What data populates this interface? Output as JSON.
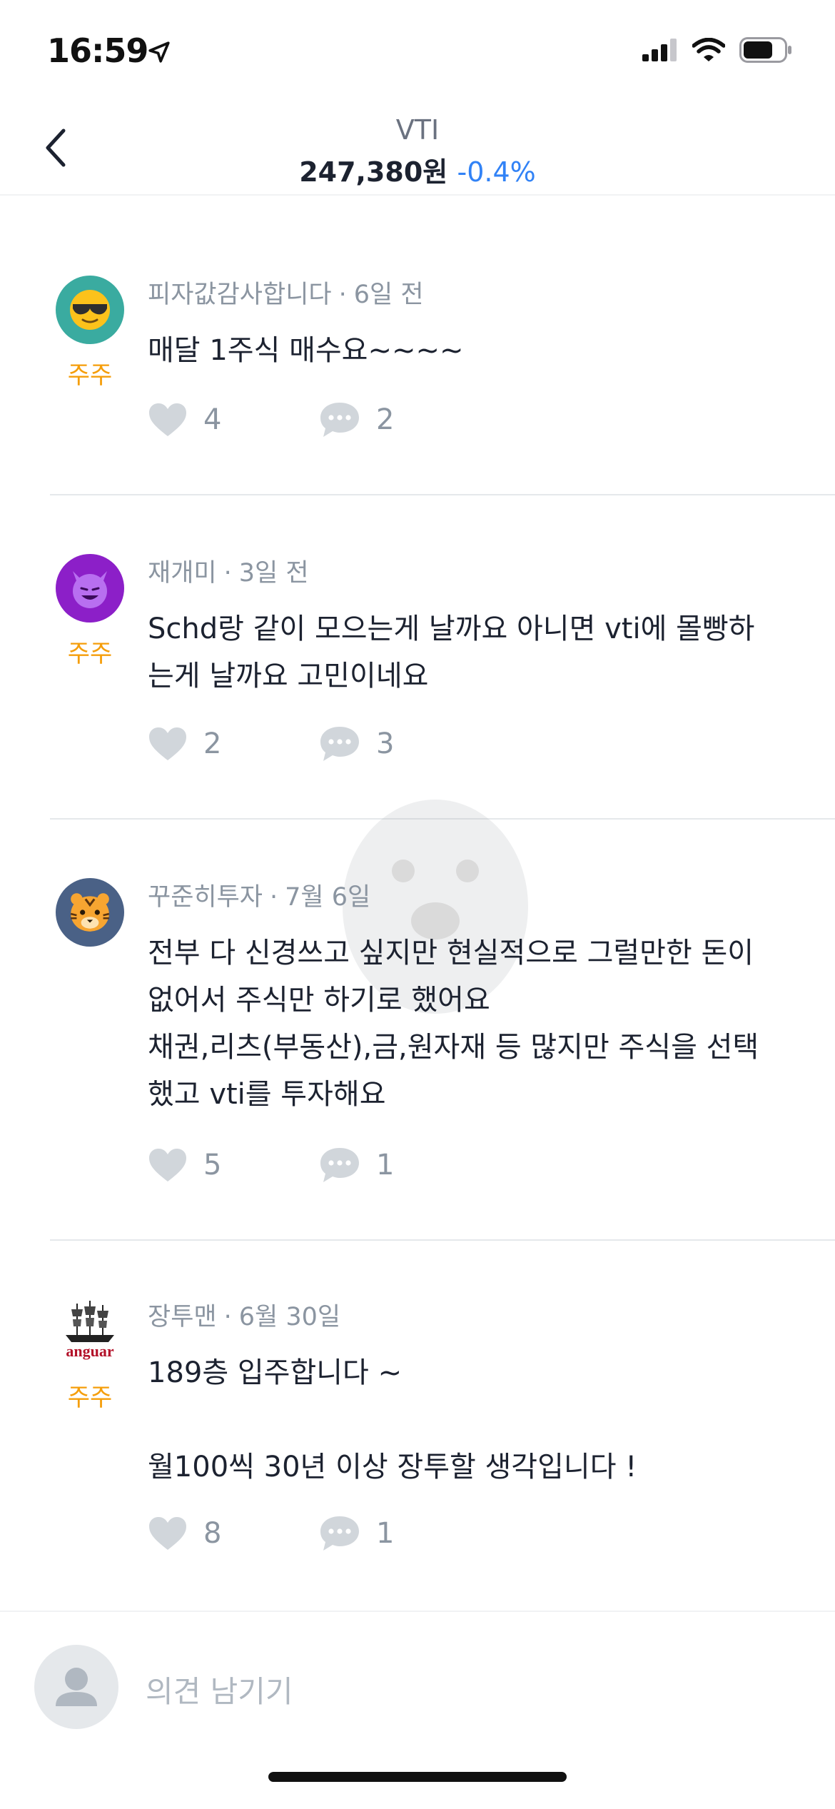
{
  "status_bar": {
    "time": "16:59"
  },
  "header": {
    "ticker": "VTI",
    "price": "247,380원",
    "change": "-0.4%",
    "change_color": "#3182f6"
  },
  "posts": [
    {
      "author": "피자값감사합니다",
      "time": "6일 전",
      "badge": "주주",
      "avatar_icon": "sunglasses-face-icon",
      "lines": [
        "매달 1주식 매수요~~~~"
      ],
      "likes": "4",
      "comments": "2"
    },
    {
      "author": "재개미",
      "time": "3일 전",
      "badge": "주주",
      "avatar_icon": "smiling-devil-icon",
      "lines": [
        "Schd랑 같이 모으는게 날까요 아니면 vti에 몰빵하",
        "는게 날까요 고민이네요"
      ],
      "likes": "2",
      "comments": "3"
    },
    {
      "author": "꾸준히투자",
      "time": "7월 6일",
      "badge": "",
      "avatar_icon": "tiger-face-icon",
      "lines": [
        "전부 다 신경쓰고 싶지만 현실적으로 그럴만한 돈이",
        "없어서 주식만 하기로 했어요",
        "채권,리츠(부동산),금,원자재 등 많지만 주식을 선택",
        "했고 vti를 투자해요"
      ],
      "likes": "5",
      "comments": "1"
    },
    {
      "author": "장투맨",
      "time": "6월 30일",
      "badge": "주주",
      "avatar_icon": "vanguard-ship-logo-icon",
      "avatar_text": "anguar",
      "lines": [
        "189층 입주합니다 ~",
        "",
        "월100씩 30년 이상 장투할 생각입니다 !"
      ],
      "likes": "8",
      "comments": "1"
    }
  ],
  "input": {
    "placeholder": "의견 남기기"
  },
  "colors": {
    "badge": "#f59e0b",
    "muted": "#8b95a1",
    "text": "#1c2230",
    "accent_blue": "#3182f6"
  }
}
